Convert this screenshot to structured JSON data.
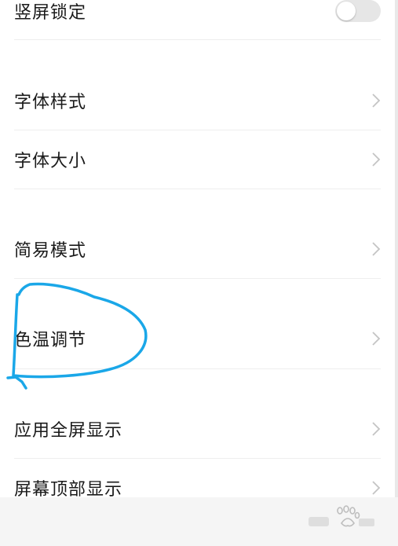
{
  "settings": {
    "items": [
      {
        "label": "竖屏锁定",
        "control": "toggle",
        "on": false
      },
      {
        "label": "字体样式",
        "control": "chevron"
      },
      {
        "label": "字体大小",
        "control": "chevron"
      },
      {
        "label": "简易模式",
        "control": "chevron"
      },
      {
        "label": "色温调节",
        "control": "chevron"
      },
      {
        "label": "应用全屏显示",
        "control": "chevron"
      },
      {
        "label": "屏幕顶部显示",
        "control": "chevron"
      }
    ]
  },
  "icons": {
    "chevron": "chevron-right-icon",
    "watermark": "baidu-paw-logo"
  },
  "colors": {
    "annotation": "#1aa7e8",
    "text": "#1a1a1a",
    "chevron": "#c4c4c4",
    "divider": "#eeeeee",
    "toggle_off": "#e6e6e6",
    "bottom_bar": "#f5f5f5"
  }
}
